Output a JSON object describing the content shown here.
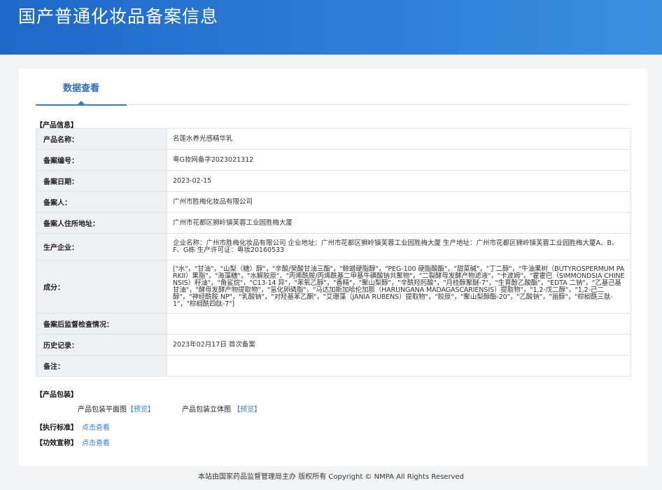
{
  "header": {
    "title": "国产普通化妆品备案信息"
  },
  "tabs": [
    {
      "label": "数据查看"
    }
  ],
  "sections": {
    "product_info": "【产品信息】",
    "product_package": "【产品包装】",
    "standard": "【执行标准】",
    "efficacy": "【功效宣称】"
  },
  "product": {
    "rows": [
      {
        "label": "产品名称：",
        "value": "名莲水养光感精华乳"
      },
      {
        "label": "备案编号：",
        "value": "粤G妆网备字2023021312"
      },
      {
        "label": "备案日期：",
        "value": "2023-02-15"
      },
      {
        "label": "备案人：",
        "value": "广州市胜梅化妆品有限公司"
      },
      {
        "label": "备案人住所地址：",
        "value": "广州市花都区狮岭镇芙蓉工业园胜梅大厦"
      },
      {
        "label": "生产企业：",
        "value": "企业名称：广州市胜梅化妆品有限公司 企业地址：广州市花都区狮岭镇芙蓉工业园胜梅大厦 生产地址：广州市花都区狮岭镇芙蓉工业园胜梅大厦A、B、F、G栋 生产许可证：粤妆20160533"
      },
      {
        "label": "成分：",
        "value": "[\"水\"，\"甘油\"，\"山梨（糖）醇\"，\"辛酸/癸酸甘油三酯\"，\"鲸蜡硬脂醇\"，\"PEG-100 硬脂酸酯\"，\"甜菜碱\"，\"丁二醇\"，\"牛油果树（BUTYROSPERMUM PARKII）果脂\"，\"海藻糖\"，\"水解胶原\"，\"丙烯酰胺/丙烯酰基二甲基牛磺酸钠共聚物\"，\"二裂酵母发酵产物滤液\"，\"卡波姆\"，\"霍霍巴（SIMMONDSIA CHINENSIS）籽油\"，\"角鲨烷\"，\"C13-14 异\"，\"苯氧乙醇\"，\"香精\"，\"聚山梨醇\"，\"辛酰羟肟酸\"，\"月桂醇聚醚-7\"，\"生育酚乙酸酯\"，\"EDTA 二钠\"，\"乙基己基甘油\"，\"酵母发酵产物提取物\"，\"氢化卵磷脂\"，\"马达加斯加哈伦加那（HARUNGANA MADAGASCARIENSIS）提取物\"，\"1,2-戊二醇\"，\"1,2-己二醇\"，\"神经酰胺 NP\"，\"乳酸钠\"，\"对羟基苯乙酮\"，\"艾珊藻（JANIA RUBENS）提取物\"，\"胶原\"，\"聚山梨醇酯-20\"，\"乙酸钠\"，\"甾醇\"，\"棕榈酰三肽-1\"，\"棕榈酰四肽-7\"]"
      },
      {
        "label": "备案后监督检查情况：",
        "value": ""
      },
      {
        "label": "历史记录：",
        "value": "2023年02月17日 首次备案"
      },
      {
        "label": "备注：",
        "value": ""
      }
    ]
  },
  "package": {
    "flat_label": "产品包装平面图",
    "flat_link": "【预览】",
    "solid_label": "产品包装立体图",
    "solid_link": "【预览】"
  },
  "links": {
    "standard": "点击查看",
    "efficacy": "点击查看"
  },
  "footer": {
    "text": "本站由国家药品监督管理局主办 版权所有 Copyright © NMPA All Rights Reserved"
  }
}
